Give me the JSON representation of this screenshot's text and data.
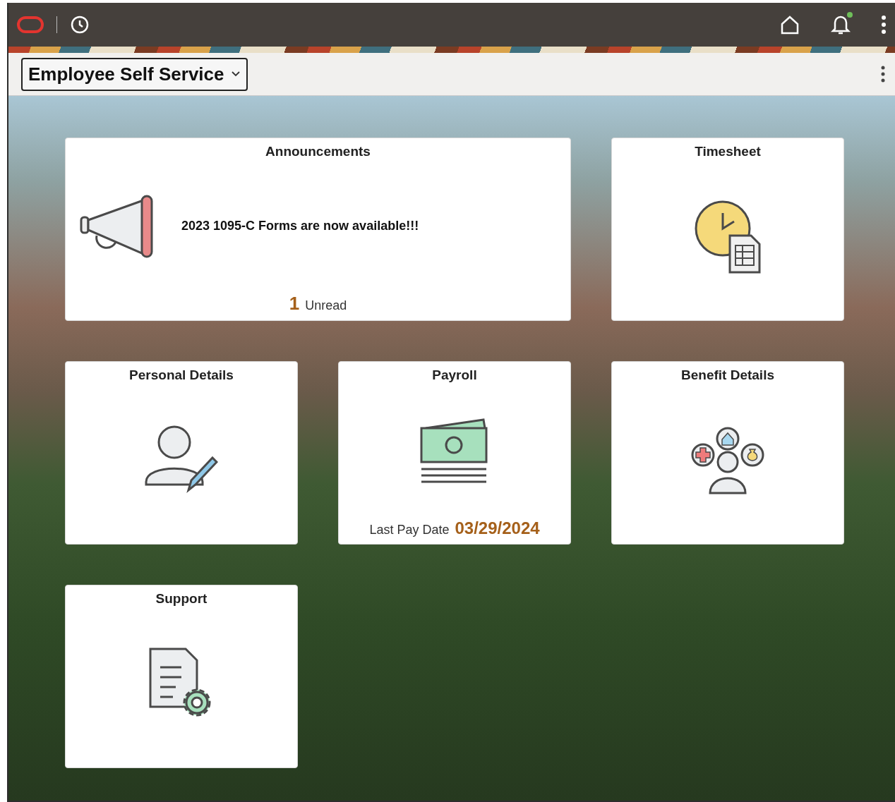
{
  "top_bar": {
    "notification_unread": true
  },
  "header": {
    "title": "Employee Self Service"
  },
  "tiles": [
    {
      "kind": "announcements",
      "title": "Announcements",
      "message": "2023 1095-C Forms are now available!!!",
      "count": "1",
      "count_label": "Unread"
    },
    {
      "kind": "timesheet",
      "title": "Timesheet"
    },
    {
      "kind": "personal",
      "title": "Personal Details"
    },
    {
      "kind": "payroll",
      "title": "Payroll",
      "footer_label": "Last Pay Date",
      "footer_value": "03/29/2024"
    },
    {
      "kind": "benefits",
      "title": "Benefit Details"
    },
    {
      "kind": "support",
      "title": "Support"
    }
  ]
}
